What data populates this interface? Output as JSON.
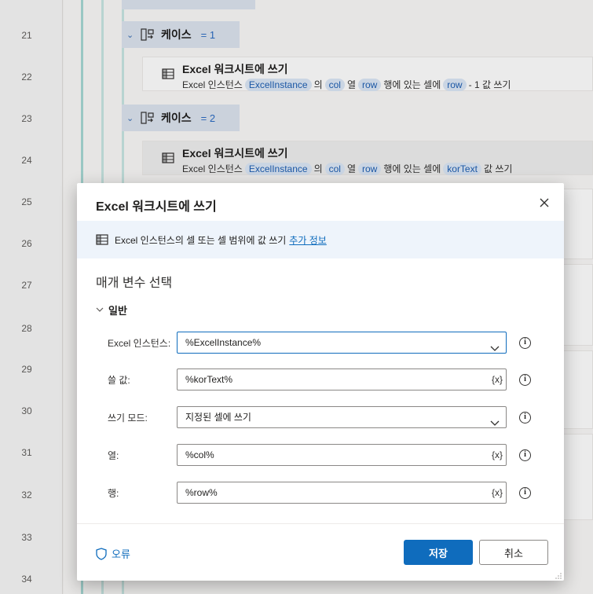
{
  "background": {
    "line_numbers": [
      "21",
      "22",
      "23",
      "24",
      "25",
      "26",
      "27",
      "28",
      "29",
      "30",
      "31",
      "32",
      "33",
      "34"
    ],
    "case1": {
      "title": "케이스",
      "value": "= 1"
    },
    "case2": {
      "title": "케이스",
      "value": "= 2"
    },
    "action1": {
      "title": "Excel 워크시트에 쓰기",
      "desc_prefix": "Excel 인스턴스",
      "chip_instance": "ExcelInstance",
      "desc_of": "의",
      "chip_col": "col",
      "desc_col": "열",
      "chip_row": "row",
      "desc_cell": "행에 있는 셀에",
      "chip_value": "row",
      "desc_suffix": "- 1 값 쓰기"
    },
    "action2": {
      "title": "Excel 워크시트에 쓰기",
      "desc_prefix": "Excel 인스턴스",
      "chip_instance": "ExcelInstance",
      "desc_of": "의",
      "chip_col": "col",
      "desc_col": "열",
      "chip_row": "row",
      "desc_cell": "행에 있는 셀에",
      "chip_value": "korText",
      "desc_suffix": "값 쓰기"
    }
  },
  "dialog": {
    "title": "Excel 워크시트에 쓰기",
    "info_text": "Excel 인스턴스의 셀 또는 셀 범위에 값 쓰기",
    "info_link": "추가 정보",
    "section_title": "매개 변수 선택",
    "group_label": "일반",
    "fields": {
      "instance": {
        "label": "Excel 인스턴스:",
        "value": "%ExcelInstance%"
      },
      "value": {
        "label": "쓸 값:",
        "value": "%korText%"
      },
      "mode": {
        "label": "쓰기 모드:",
        "value": "지정된 셀에 쓰기"
      },
      "column": {
        "label": "열:",
        "value": "%col%"
      },
      "row": {
        "label": "행:",
        "value": "%row%"
      }
    },
    "var_button": "{x}",
    "info_glyph": "i",
    "error_label": "오류",
    "save_label": "저장",
    "cancel_label": "취소"
  },
  "colors": {
    "accent": "#0f6cbd",
    "chip_bg": "#dce8f7",
    "case_bg": "#dde4ef"
  },
  "icons": {
    "close": "close-icon",
    "excel": "excel-sheet-icon",
    "case": "case-icon",
    "dropdown": "chevron-down-icon",
    "info": "info-icon",
    "shield": "shield-icon"
  }
}
